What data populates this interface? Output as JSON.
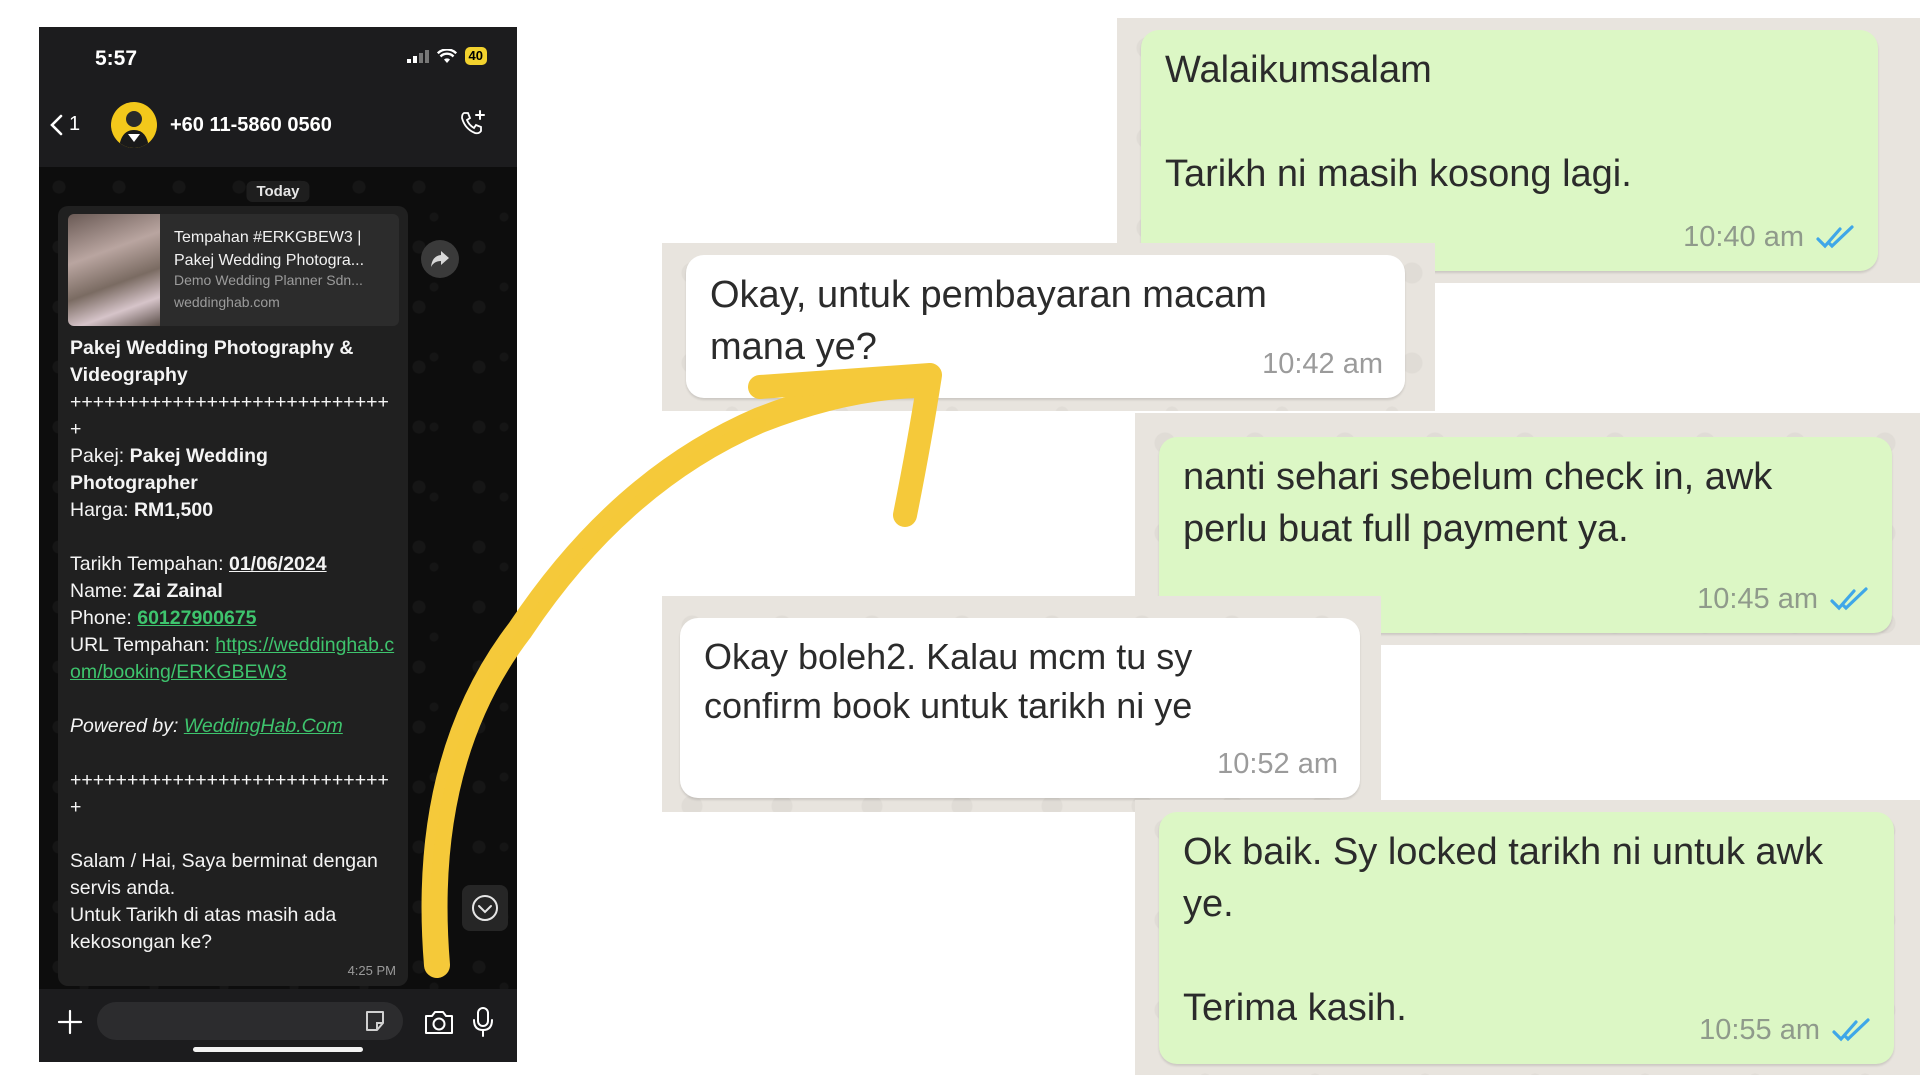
{
  "phone": {
    "status": {
      "time": "5:57",
      "battery": "40"
    },
    "header": {
      "back_count": "1",
      "contact": "+60 11-5860 0560"
    },
    "chat": {
      "date_divider": "Today",
      "link_preview": {
        "title": "Tempahan #ERKGBEW3 | Pakej Wedding Photogra...",
        "description": "Demo Wedding Planner Sdn...",
        "domain": "weddinghab.com"
      },
      "message": {
        "heading": "Pakej Wedding Photography & Videography",
        "separator": "+++++++++++++++++++++++++++++",
        "package_label": "Pakej: ",
        "package_value": "Pakej Wedding Photographer",
        "price_label": "Harga: ",
        "price_value": "RM1,500",
        "date_label": "Tarikh Tempahan: ",
        "date_value": "01/06/2024",
        "name_label": "Name: ",
        "name_value": "Zai Zainal",
        "phone_label": "Phone: ",
        "phone_value": "60127900675",
        "url_label": "URL Tempahan: ",
        "url_value": "https://weddinghab.com/booking/ERKGBEW3",
        "powered_label": "Powered by: ",
        "powered_value": "WeddingHab.Com",
        "closing_1": "Salam / Hai, Saya berminat dengan servis anda.",
        "closing_2": "Untuk Tarikh di atas masih ada kekosongan ke?",
        "time": "4:25 PM"
      }
    },
    "composer": {
      "placeholder": ""
    }
  },
  "zoomed_chat": [
    {
      "direction": "outgoing",
      "text": "Walaikumsalam\n\nTarikh ni masih kosong lagi.",
      "time": "10:40 am",
      "read": true
    },
    {
      "direction": "incoming",
      "text": "Okay, untuk pembayaran macam\nmana ye?",
      "time": "10:42 am"
    },
    {
      "direction": "outgoing",
      "text": "nanti sehari sebelum check in, awk\nperlu buat full payment ya.",
      "time": "10:45 am",
      "read": true
    },
    {
      "direction": "incoming",
      "text": "Okay boleh2. Kalau mcm tu sy\nconfirm book untuk tarikh ni ye",
      "time": "10:52 am"
    },
    {
      "direction": "outgoing",
      "text": "Ok baik. Sy locked tarikh ni untuk awk\nye.\n\nTerima kasih.",
      "time": "10:55 am",
      "read": true
    }
  ],
  "colors": {
    "outgoing_bubble": "#dcf7c5",
    "incoming_bubble": "#ffffff",
    "read_ticks": "#3fa7e8",
    "link": "#3ec46d",
    "arrow": "#f5c93a"
  }
}
